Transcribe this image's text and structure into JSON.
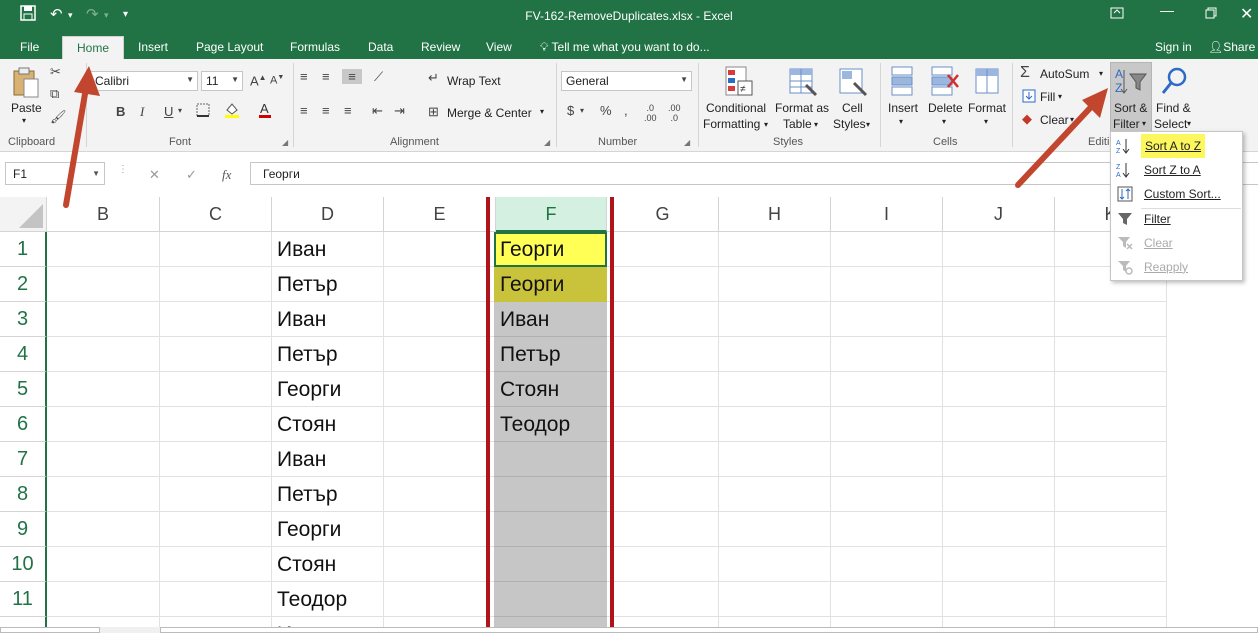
{
  "window": {
    "title": "FV-162-RemoveDuplicates.xlsx - Excel"
  },
  "tabs": [
    "File",
    "Home",
    "Insert",
    "Page Layout",
    "Formulas",
    "Data",
    "Review",
    "View"
  ],
  "active_tab": "Home",
  "tellme": "Tell me what you want to do...",
  "signin": "Sign in",
  "share": "Share",
  "ribbon": {
    "clipboard": {
      "label": "Clipboard",
      "paste": "Paste"
    },
    "font": {
      "label": "Font",
      "name": "Calibri",
      "size": "11",
      "bold": "B",
      "italic": "I",
      "underline": "U"
    },
    "alignment": {
      "label": "Alignment",
      "wrap": "Wrap Text",
      "merge": "Merge & Center"
    },
    "number": {
      "label": "Number",
      "format": "General",
      "currency": "$",
      "percent": "%"
    },
    "styles": {
      "label": "Styles",
      "conditional": [
        "Conditional",
        "Formatting"
      ],
      "format_as_table": [
        "Format as",
        "Table"
      ],
      "cell_styles": [
        "Cell",
        "Styles"
      ]
    },
    "cells": {
      "label": "Cells",
      "insert": "Insert",
      "delete": "Delete",
      "format": "Format"
    },
    "editing": {
      "label": "Editi",
      "autosum": "AutoSum",
      "fill": "Fill",
      "clear": "Clear",
      "sort_filter": [
        "Sort &",
        "Filter"
      ],
      "find_select": [
        "Find &",
        "Select"
      ]
    }
  },
  "formula_bar": {
    "name_box": "F1",
    "content": "Георги"
  },
  "columns": [
    "B",
    "C",
    "D",
    "E",
    "F",
    "G",
    "H",
    "I",
    "J",
    "K"
  ],
  "selected_column": "F",
  "rows": [
    "1",
    "2",
    "3",
    "4",
    "5",
    "6",
    "7",
    "8",
    "9",
    "10",
    "11"
  ],
  "column_d": [
    "Иван",
    "Петър",
    "Иван",
    "Петър",
    "Георги",
    "Стоян",
    "Иван",
    "Петър",
    "Георги",
    "Стоян",
    "Теодор",
    "И"
  ],
  "column_f": [
    "Георги",
    "Георги",
    "Иван",
    "Петър",
    "Стоян",
    "Теодор"
  ],
  "sort_menu": {
    "items": [
      {
        "label": "Sort A to Z",
        "icon": "sort-az-icon",
        "enabled": true,
        "highlighted": true
      },
      {
        "label": "Sort Z to A",
        "icon": "sort-za-icon",
        "enabled": true
      },
      {
        "label": "Custom Sort...",
        "icon": "custom-sort-icon",
        "enabled": true
      },
      {
        "label": "Filter",
        "icon": "filter-icon",
        "enabled": true
      },
      {
        "label": "Clear",
        "icon": "clear-filter-icon",
        "enabled": false
      },
      {
        "label": "Reapply",
        "icon": "reapply-icon",
        "enabled": false
      }
    ]
  },
  "colors": {
    "excel_green": "#217346",
    "highlight_yellow": "#ffff55",
    "duplicate_olive": "#c9c23b",
    "selection_gray": "#c6c6c6",
    "callout_red": "#b0141b",
    "arrow_orange": "#c2462e"
  }
}
